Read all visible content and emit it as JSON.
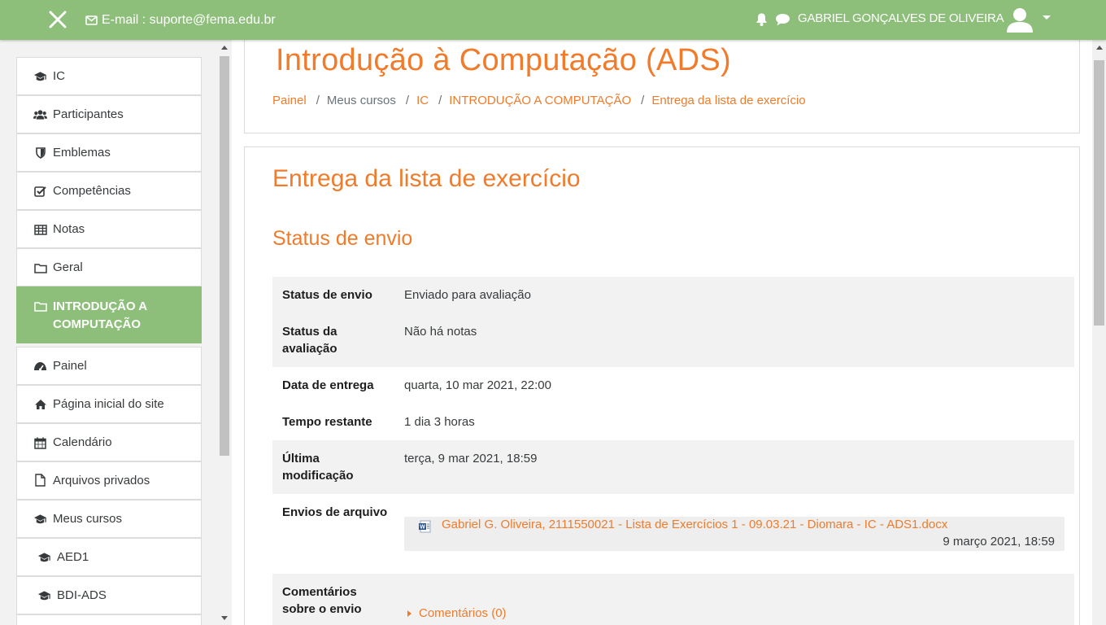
{
  "topbar": {
    "email_text": "E-mail : suporte@fema.edu.br",
    "user_name": "GABRIEL GONÇALVES DE OLIVEIRA",
    "icons": [
      "close-icon",
      "envelope-icon",
      "bell-icon",
      "chat-icon",
      "user-avatar-icon",
      "caret-down-icon"
    ],
    "color": "#8dbf7a"
  },
  "sidebar": {
    "items": [
      {
        "label": "IC",
        "icon": "graduation-cap-icon"
      },
      {
        "label": "Participantes",
        "icon": "users-icon"
      },
      {
        "label": "Emblemas",
        "icon": "shield-icon"
      },
      {
        "label": "Competências",
        "icon": "checkbox-icon"
      },
      {
        "label": "Notas",
        "icon": "table-icon"
      },
      {
        "label": "Geral",
        "icon": "folder-icon"
      },
      {
        "label": "INTRODUÇÃO A COMPUTAÇÃO",
        "icon": "folder-icon",
        "active": true
      },
      {
        "label": "Painel",
        "icon": "dashboard-icon"
      },
      {
        "label": "Página inicial do site",
        "icon": "home-icon"
      },
      {
        "label": "Calendário",
        "icon": "calendar-icon"
      },
      {
        "label": "Arquivos privados",
        "icon": "file-icon"
      },
      {
        "label": "Meus cursos",
        "icon": "graduation-cap-icon"
      },
      {
        "label": "AED1",
        "icon": "graduation-cap-icon"
      },
      {
        "label": "BDI-ADS",
        "icon": "graduation-cap-icon"
      }
    ]
  },
  "header": {
    "course_title": "Introdução à Computação (ADS)",
    "breadcrumb": [
      {
        "label": "Painel",
        "link": true
      },
      {
        "label": "Meus cursos",
        "link": false
      },
      {
        "label": "IC",
        "link": true
      },
      {
        "label": "INTRODUÇÃO A COMPUTAÇÃO",
        "link": true
      },
      {
        "label": "Entrega da lista de exercício",
        "link": true
      }
    ]
  },
  "assignment": {
    "title": "Entrega da lista de exercício",
    "section_title": "Status de envio",
    "rows": {
      "submission_status": {
        "key": "Status de envio",
        "value": "Enviado para avaliação"
      },
      "grading_status": {
        "key": "Status da avaliação",
        "value": "Não há notas"
      },
      "due_date": {
        "key": "Data de entrega",
        "value": "quarta, 10 mar 2021, 22:00"
      },
      "time_remaining": {
        "key": "Tempo restante",
        "value": "1 dia 3 horas"
      },
      "last_modified": {
        "key": "Última modificação",
        "value": "terça, 9 mar 2021, 18:59"
      },
      "file_submissions": {
        "key": "Envios de arquivo",
        "file_name": "Gabriel G. Oliveira, 2111550021 - Lista de Exercícios 1 - 09.03.21 - Diomara - IC - ADS1.docx",
        "file_date": "9 março 2021, 18:59",
        "file_icon": "word-doc-icon"
      },
      "submission_comments": {
        "key": "Comentários sobre o envio",
        "toggle_label": "Comentários (0)"
      }
    }
  },
  "accent_color": "#f07b2a"
}
